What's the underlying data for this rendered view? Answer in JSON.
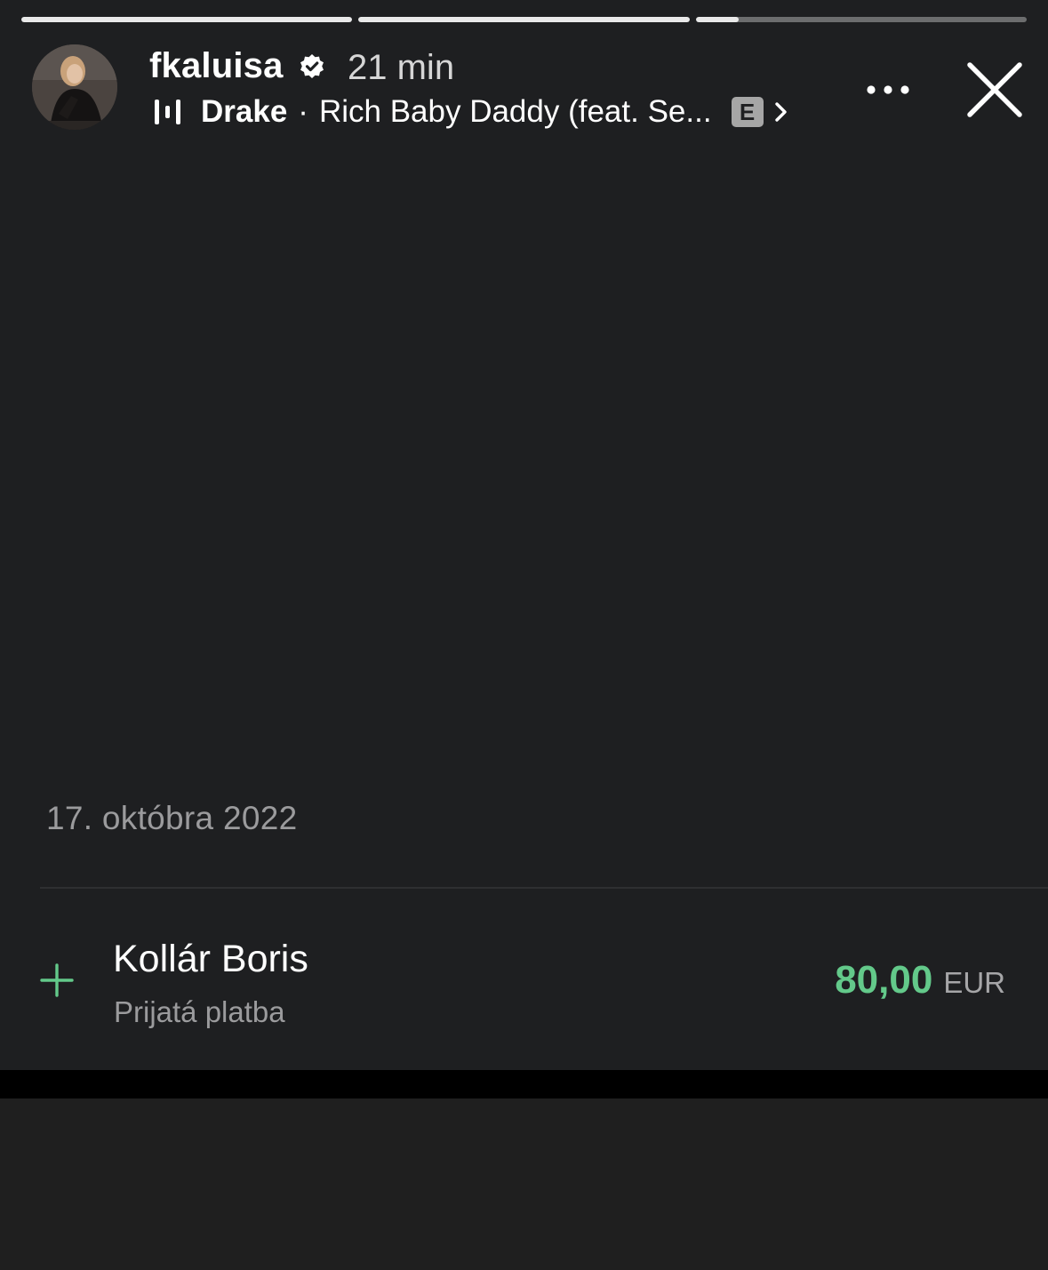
{
  "story": {
    "progress": [
      1,
      1,
      0.13
    ],
    "username": "fkaluisa",
    "verified": true,
    "time": "21 min",
    "music": {
      "artist": "Drake",
      "separator": "·",
      "song": "Rich Baby Daddy (feat. Se...",
      "explicit_badge": "E"
    },
    "icons": {
      "equalizer": "equalizer-icon",
      "more": "more-dots-icon",
      "close": "close-icon",
      "verified": "verified-badge-icon",
      "chevron": "chevron-right-icon"
    }
  },
  "transaction": {
    "date": "17. októbra 2022",
    "name": "Kollár Boris",
    "type": "Prijatá platba",
    "amount": "80,00",
    "currency": "EUR",
    "amount_color": "#63c98a",
    "sign_icon": "plus-icon"
  }
}
